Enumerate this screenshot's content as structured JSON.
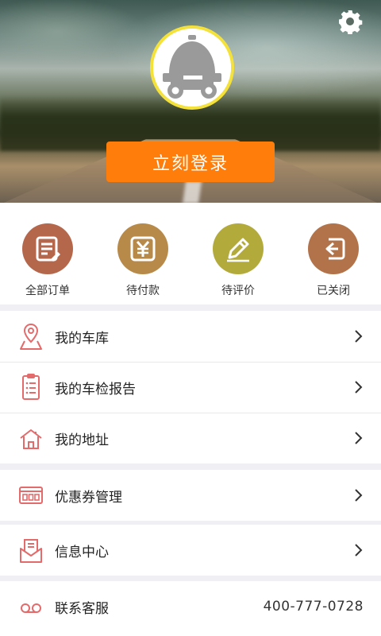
{
  "header": {
    "login_label": "立刻登录",
    "settings_icon": "gear-icon",
    "avatar_icon": "robot-avatar-icon",
    "avatar_border_color": "#f4e23b",
    "login_button_color": "#ff7e0b"
  },
  "orders": [
    {
      "label": "全部订单",
      "icon": "order-list-icon",
      "color": "#b5674c"
    },
    {
      "label": "待付款",
      "icon": "yen-icon",
      "color": "#b88a4a"
    },
    {
      "label": "待评价",
      "icon": "pencil-icon",
      "color": "#b3aa3c"
    },
    {
      "label": "已关闭",
      "icon": "exit-icon",
      "color": "#b3734a"
    }
  ],
  "menu": {
    "garage": "我的车库",
    "inspection_report": "我的车检报告",
    "address": "我的地址",
    "coupons": "优惠券管理",
    "messages": "信息中心",
    "customer_service": "联系客服",
    "service_phone": "400-777-0728"
  },
  "colors": {
    "menu_icon": "#e36b6b",
    "chevron": "#333333",
    "background": "#efeff4"
  }
}
